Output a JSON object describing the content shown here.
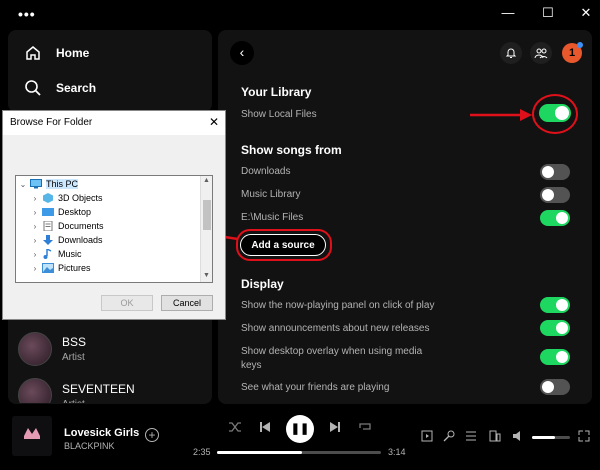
{
  "window": {
    "menu_dots": "•••",
    "minimize": "—",
    "maximize": "☐",
    "close": "✕"
  },
  "nav": {
    "home": "Home",
    "search": "Search"
  },
  "library": {
    "artists": [
      {
        "name": "BSS",
        "type": "Artist"
      },
      {
        "name": "SEVENTEEN",
        "type": "Artist"
      }
    ]
  },
  "settings": {
    "avatar_initial": "1",
    "your_library": {
      "heading": "Your Library",
      "show_local_files": "Show Local Files",
      "show_local_files_on": true
    },
    "show_songs_from": {
      "heading": "Show songs from",
      "sources": [
        {
          "label": "Downloads",
          "on": false
        },
        {
          "label": "Music Library",
          "on": false
        },
        {
          "label": "E:\\Music Files",
          "on": true
        }
      ],
      "add_source": "Add a source"
    },
    "display": {
      "heading": "Display",
      "options": [
        {
          "label": "Show the now-playing panel on click of play",
          "on": true
        },
        {
          "label": "Show announcements about new releases",
          "on": true
        },
        {
          "label": "Show desktop overlay when using media",
          "label2": "keys",
          "on": true
        },
        {
          "label": "See what your friends are playing",
          "on": false
        }
      ]
    }
  },
  "dialog": {
    "title": "Browse For Folder",
    "close": "✕",
    "tree": [
      "This PC",
      "3D Objects",
      "Desktop",
      "Documents",
      "Downloads",
      "Music",
      "Pictures"
    ],
    "ok": "OK",
    "cancel": "Cancel"
  },
  "player": {
    "track": "Lovesick Girls",
    "artist": "BLACKPINK",
    "elapsed": "2:35",
    "duration": "3:14",
    "progress": 0.52,
    "volume": 0.6
  },
  "colors": {
    "accent": "#1ed760",
    "annotation": "#e0101a"
  }
}
